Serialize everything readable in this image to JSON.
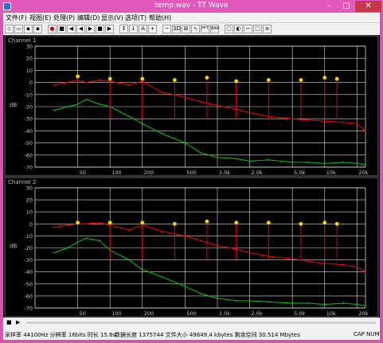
{
  "window": {
    "title": "temp.wav - TT Wave",
    "min_glyph": "–",
    "max_glyph": "□",
    "close_glyph": "✕"
  },
  "menu": [
    "文件(F)",
    "视图(E)",
    "处理(P)",
    "编辑(D)",
    "显示(V)",
    "选项(T)",
    "帮助(H)"
  ],
  "toolbar": {
    "groups": [
      [
        "new",
        "open",
        "save",
        "save-as"
      ],
      [
        "record",
        "stop",
        "rewind",
        "skip-back",
        "play",
        "pause",
        "skip-forward"
      ],
      [
        "meter",
        "marker",
        "text",
        "zoom-in"
      ],
      [
        "curve",
        "3d",
        "view",
        "scope",
        "spectrum",
        "bar"
      ],
      [
        "window",
        "overlay",
        "bracket",
        "rect",
        "list"
      ]
    ],
    "labels": {
      "3d": "3D",
      "spectrum": "FFT",
      "bar": "BAR"
    }
  },
  "charts": [
    {
      "label": "Channel 1",
      "unit": "dB"
    },
    {
      "label": "Channel 2",
      "unit": "dB"
    }
  ],
  "chart_data": [
    {
      "type": "line",
      "title": "Channel 1",
      "ylabel": "dB",
      "xscale": "log",
      "xlim": [
        20,
        24000
      ],
      "ylim": [
        -70,
        30
      ],
      "yticks": [
        "30",
        "20",
        "10",
        "0",
        "-10",
        "-20",
        "-30",
        "-40",
        "-50",
        "-60",
        "-70"
      ],
      "xticks": [
        "50",
        "100",
        "200",
        "500",
        "1.0k",
        "2.0k",
        "5.0k",
        "10k",
        "20k"
      ],
      "grid": true,
      "series": [
        {
          "color": "#ff0000",
          "x": [
            30,
            40,
            50,
            60,
            80,
            100,
            150,
            200,
            300,
            500,
            700,
            1000,
            1500,
            2000,
            3000,
            5000,
            7000,
            10000,
            15000,
            20000,
            24000
          ],
          "y": [
            -2,
            0,
            2,
            0,
            2,
            1,
            -2,
            1,
            -8,
            -12,
            -16,
            -19,
            -22,
            -25,
            -28,
            -30,
            -31,
            -32,
            -33,
            -34,
            -40
          ]
        },
        {
          "color": "#00cc00",
          "x": [
            30,
            40,
            50,
            60,
            80,
            100,
            150,
            200,
            300,
            500,
            700,
            1000,
            1500,
            2000,
            3000,
            5000,
            7000,
            10000,
            15000,
            20000,
            24000
          ],
          "y": [
            -23,
            -20,
            -18,
            -14,
            -18,
            -20,
            -28,
            -34,
            -42,
            -50,
            -58,
            -62,
            -63,
            -65,
            -64,
            -66,
            -66,
            -67,
            -66,
            -67,
            -68
          ]
        }
      ],
      "markers": {
        "x": [
          50,
          100,
          200,
          400,
          800,
          1500,
          3000,
          6000,
          10000,
          13000
        ],
        "y": [
          5,
          3,
          3,
          2,
          4,
          1,
          2,
          2,
          4,
          3
        ]
      }
    },
    {
      "type": "line",
      "title": "Channel 2",
      "ylabel": "dB",
      "xscale": "log",
      "xlim": [
        20,
        24000
      ],
      "ylim": [
        -70,
        30
      ],
      "yticks": [
        "30",
        "20",
        "10",
        "0",
        "-10",
        "-20",
        "-30",
        "-40",
        "-50",
        "-60",
        "-70"
      ],
      "xticks": [
        "50",
        "100",
        "200",
        "500",
        "1.0k",
        "2.0k",
        "5.0k",
        "10k",
        "20k"
      ],
      "grid": true,
      "series": [
        {
          "color": "#ff0000",
          "x": [
            30,
            40,
            50,
            60,
            80,
            100,
            150,
            200,
            300,
            500,
            700,
            1000,
            1500,
            2000,
            3000,
            5000,
            7000,
            10000,
            15000,
            20000,
            24000
          ],
          "y": [
            -3,
            -1,
            0,
            0,
            1,
            -1,
            -5,
            -1,
            -6,
            -10,
            -14,
            -18,
            -21,
            -24,
            -27,
            -29,
            -31,
            -33,
            -34,
            -36,
            -40
          ]
        },
        {
          "color": "#00cc00",
          "x": [
            30,
            40,
            50,
            60,
            80,
            100,
            150,
            200,
            300,
            500,
            700,
            1000,
            1500,
            2000,
            3000,
            5000,
            7000,
            10000,
            15000,
            20000,
            24000
          ],
          "y": [
            -24,
            -20,
            -15,
            -12,
            -14,
            -22,
            -30,
            -38,
            -44,
            -52,
            -58,
            -62,
            -64,
            -64,
            -65,
            -66,
            -66,
            -67,
            -66,
            -67,
            -68
          ]
        }
      ],
      "markers": {
        "x": [
          50,
          100,
          200,
          400,
          800,
          1500,
          3000,
          6000,
          10000,
          13000
        ],
        "y": [
          1,
          1,
          1,
          0,
          2,
          1,
          1,
          0,
          1,
          0
        ]
      }
    }
  ],
  "status": {
    "line1": "采样率 44100Hz  分辨率 16bits  时长 15.6s",
    "line2": "数据长度 1375744  文件大小 49849.4 kbytes  剩余空间 30.514 Mbytes",
    "indicators": "CAP  NUM"
  }
}
